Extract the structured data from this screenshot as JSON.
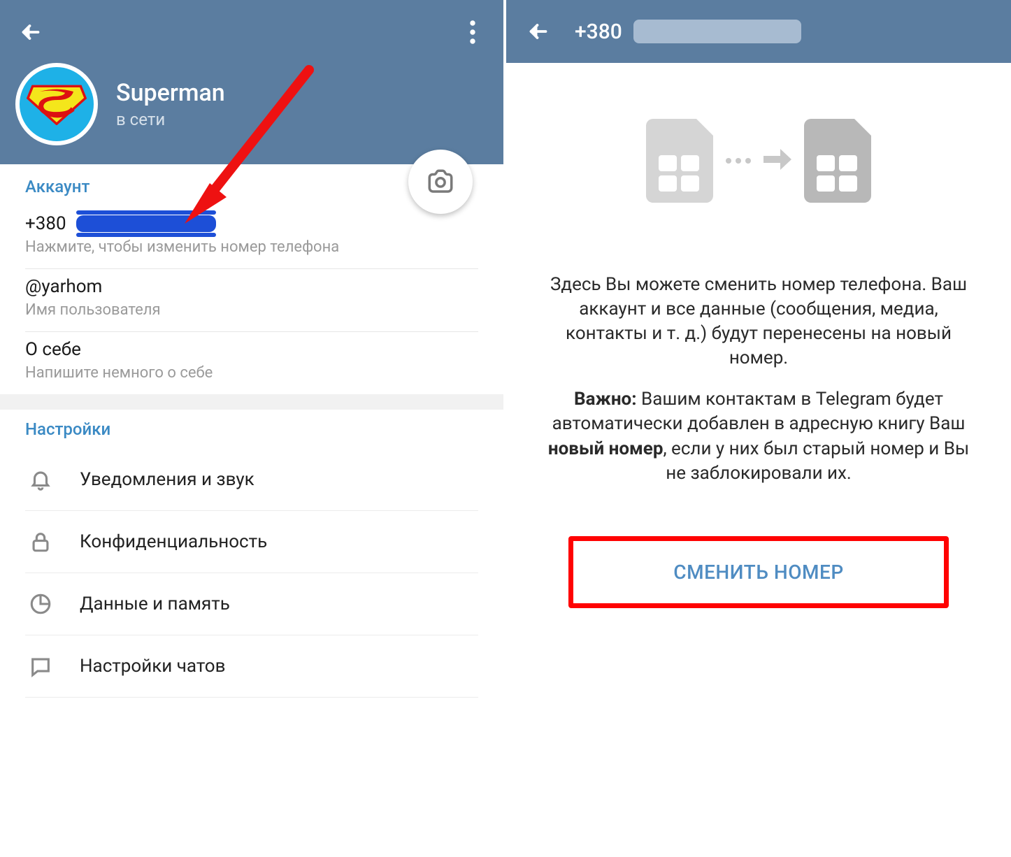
{
  "left": {
    "profile": {
      "name": "Superman",
      "status": "в сети"
    },
    "account": {
      "section_title": "Аккаунт",
      "phone_prefix": "+380",
      "phone_hint": "Нажмите, чтобы изменить номер телефона",
      "username": "@yarhom",
      "username_hint": "Имя пользователя",
      "bio_label": "О себе",
      "bio_hint": "Напишите немного о себе"
    },
    "settings": {
      "section_title": "Настройки",
      "items": [
        {
          "label": "Уведомления и звук"
        },
        {
          "label": "Конфиденциальность"
        },
        {
          "label": "Данные и память"
        },
        {
          "label": "Настройки чатов"
        }
      ]
    }
  },
  "right": {
    "title_prefix": "+380",
    "explain_p1": "Здесь Вы можете сменить номер телефона. Ваш аккаунт и все данные (сообщения, медиа, контакты и т. д.) будут перенесены на новый номер.",
    "important_label": "Важно:",
    "explain_p2a": " Вашим контактам в Telegram будет автоматически добавлен в адресную книгу Ваш ",
    "new_number_bold": "новый номер",
    "explain_p2b": ", если у них был старый номер и Вы не заблокировали их.",
    "button_label": "СМЕНИТЬ НОМЕР"
  }
}
